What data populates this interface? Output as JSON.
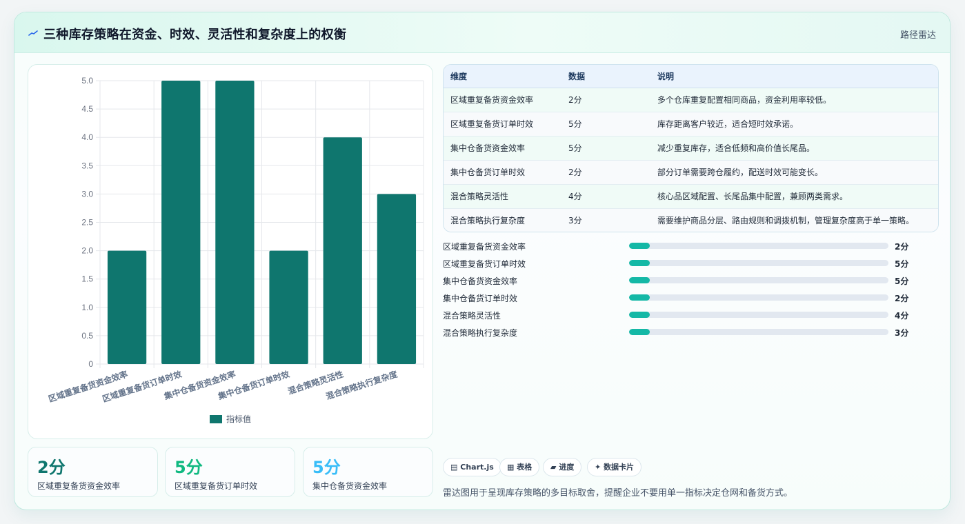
{
  "header": {
    "icon": "wave-icon",
    "title": "三种库存策略在资金、时效、灵活性和复杂度上的权衡",
    "tag": "路径雷达"
  },
  "colors": {
    "bar": "#0f766e",
    "accent_fill": "#14b8a6",
    "stat1": "#0f766e",
    "stat2": "#10b981",
    "stat3": "#38bdf8"
  },
  "chart_data": {
    "type": "bar",
    "categories": [
      "区域重复备货资金效率",
      "区域重复备货订单时效",
      "集中仓备货资金效率",
      "集中仓备货订单时效",
      "混合策略灵活性",
      "混合策略执行复杂度"
    ],
    "series": [
      {
        "name": "指标值",
        "values": [
          2,
          5,
          5,
          2,
          4,
          3
        ]
      }
    ],
    "ylim": [
      0,
      5
    ],
    "yticks": [
      "0",
      "0.5",
      "1.0",
      "1.5",
      "2.0",
      "2.5",
      "3.0",
      "3.5",
      "4.0",
      "4.5",
      "5.0"
    ],
    "grid": true,
    "legend": "bottom"
  },
  "table": {
    "headers": [
      "维度",
      "数据",
      "说明"
    ],
    "rows": [
      [
        "区域重复备货资金效率",
        "2分",
        "多个仓库重复配置相同商品，资金利用率较低。"
      ],
      [
        "区域重复备货订单时效",
        "5分",
        "库存距离客户较近，适合短时效承诺。"
      ],
      [
        "集中仓备货资金效率",
        "5分",
        "减少重复库存，适合低频和高价值长尾品。"
      ],
      [
        "集中仓备货订单时效",
        "2分",
        "部分订单需要跨仓履约，配送时效可能变长。"
      ],
      [
        "混合策略灵活性",
        "4分",
        "核心品区域配置、长尾品集中配置，兼顾两类需求。"
      ],
      [
        "混合策略执行复杂度",
        "3分",
        "需要维护商品分层、路由规则和调拨机制，管理复杂度高于单一策略。"
      ]
    ]
  },
  "progress": [
    {
      "label": "区域重复备货资金效率",
      "value": "2分",
      "fill": 0.08
    },
    {
      "label": "区域重复备货订单时效",
      "value": "5分",
      "fill": 0.08
    },
    {
      "label": "集中仓备货资金效率",
      "value": "5分",
      "fill": 0.08
    },
    {
      "label": "集中仓备货订单时效",
      "value": "2分",
      "fill": 0.08
    },
    {
      "label": "混合策略灵活性",
      "value": "4分",
      "fill": 0.08
    },
    {
      "label": "混合策略执行复杂度",
      "value": "3分",
      "fill": 0.08
    }
  ],
  "stats": [
    {
      "value": "2分",
      "label": "区域重复备货资金效率"
    },
    {
      "value": "5分",
      "label": "区域重复备货订单时效"
    },
    {
      "value": "5分",
      "label": "集中仓备货资金效率"
    }
  ],
  "chips": [
    {
      "icon": "chart-icon",
      "glyph": "▤",
      "label": "Chart.js"
    },
    {
      "icon": "table-icon",
      "glyph": "▦",
      "label": "表格"
    },
    {
      "icon": "progress-icon",
      "glyph": "▰",
      "label": "进度"
    },
    {
      "icon": "sparkle-icon",
      "glyph": "✦",
      "label": "数据卡片"
    }
  ],
  "footnote": "雷达图用于呈现库存策略的多目标取舍，提醒企业不要用单一指标决定仓网和备货方式。"
}
